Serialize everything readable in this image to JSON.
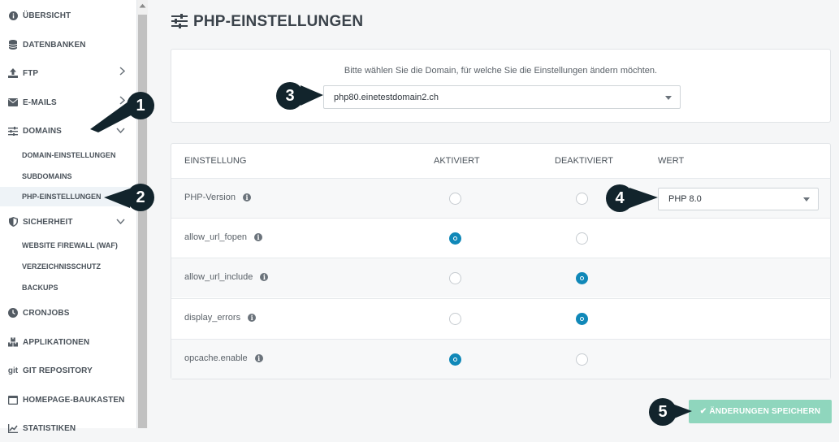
{
  "sidebar": {
    "items": [
      {
        "label": "ÜBERSICHT",
        "icon": "info-icon"
      },
      {
        "label": "DATENBANKEN",
        "icon": "database-icon"
      },
      {
        "label": "FTP",
        "icon": "upload-icon"
      },
      {
        "label": "E-MAILS",
        "icon": "envelope-icon"
      },
      {
        "label": "DOMAINS",
        "icon": "sliders-icon"
      },
      {
        "label": "SICHERHEIT",
        "icon": "shield-icon"
      },
      {
        "label": "CRONJOBS",
        "icon": "clock-icon"
      },
      {
        "label": "APPLIKATIONEN",
        "icon": "boxes-icon"
      },
      {
        "label": "GIT REPOSITORY",
        "icon": "git-icon"
      },
      {
        "label": "HOMEPAGE-BAUKASTEN",
        "icon": "window-icon"
      },
      {
        "label": "STATISTIKEN",
        "icon": "chart-icon"
      }
    ],
    "domains_sub": [
      "DOMAIN-EINSTELLUNGEN",
      "SUBDOMAINS",
      "PHP-EINSTELLUNGEN"
    ],
    "security_sub": [
      "WEBSITE FIREWALL (WAF)",
      "VERZEICHNISSCHUTZ",
      "BACKUPS"
    ],
    "git_prefix": "git"
  },
  "page": {
    "title": "PHP-EINSTELLUNGEN",
    "domain_prompt": "Bitte wählen Sie die Domain, für welche Sie die Einstellungen ändern möchten.",
    "domain_selected": "php80.einetestdomain2.ch"
  },
  "table": {
    "headers": {
      "setting": "EINSTELLUNG",
      "enabled": "AKTIVIERT",
      "disabled": "DEAKTIVIERT",
      "value": "WERT"
    },
    "rows": [
      {
        "name": "PHP-Version",
        "state": "none",
        "value": "PHP 8.0"
      },
      {
        "name": "allow_url_fopen",
        "state": "enabled"
      },
      {
        "name": "allow_url_include",
        "state": "disabled"
      },
      {
        "name": "display_errors",
        "state": "disabled"
      },
      {
        "name": "opcache.enable",
        "state": "enabled"
      }
    ],
    "info_glyph": "i"
  },
  "save_button": {
    "label": "ÄNDERUNGEN SPEICHERN",
    "check": "✔"
  },
  "callouts": [
    "1",
    "2",
    "3",
    "4",
    "5"
  ],
  "colors": {
    "accent": "#1088b8",
    "save": "#8fd6bd",
    "callout": "#12242c"
  }
}
